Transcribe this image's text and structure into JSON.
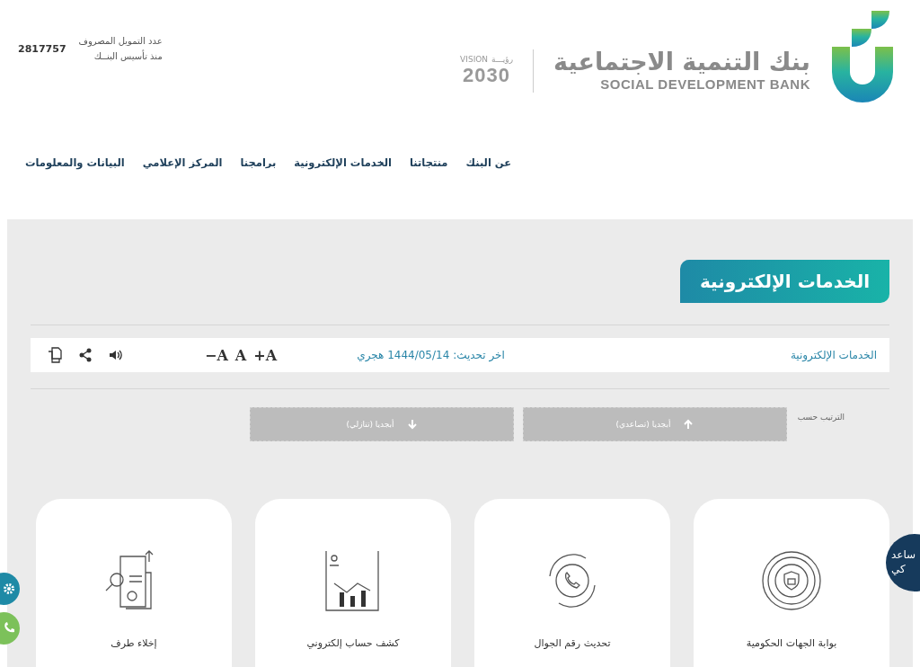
{
  "header": {
    "counter": {
      "lines": [
        "عدد التمويل المصروف",
        "منذ تأسيس البنــك"
      ],
      "value": "2817757"
    },
    "vision_logo": {
      "word": "VISION",
      "arabic": "رؤيـــة",
      "year": "2030"
    },
    "bank_logo": {
      "arabic": "بنك التنمية الاجتماعية",
      "english": "SOCIAL DEVELOPMENT BANK"
    }
  },
  "nav": [
    "عن البنك",
    "منتجاتنا",
    "الخدمات الإلكترونية",
    "برامجنا",
    "المركز الإعلامي",
    "البيانات والمعلومات"
  ],
  "page_title": "الخدمات الإلكترونية",
  "toolbar": {
    "breadcrumb": "الخدمات الإلكترونية",
    "updated": "اخر تحديث: 1444/05/14 هجري",
    "font_sizes": [
      "+A",
      "A",
      "−A"
    ]
  },
  "sort": {
    "label": "الترتيب حسب",
    "options": [
      {
        "label": "أبجديا (تصاعدي)",
        "kind": "up"
      },
      {
        "label": "أبجديا (تنازلي)",
        "kind": "down"
      }
    ]
  },
  "cards": [
    {
      "title": "بوابة الجهات الحكومية",
      "kind": "shield"
    },
    {
      "title": "تحديث رقم الجوال",
      "kind": "phone"
    },
    {
      "title": "كشف حساب إلكتروني",
      "kind": "chart"
    },
    {
      "title": "إخلاء طرف",
      "kind": "document"
    }
  ],
  "assistant": {
    "lines": [
      "ساعد",
      "كي"
    ]
  }
}
